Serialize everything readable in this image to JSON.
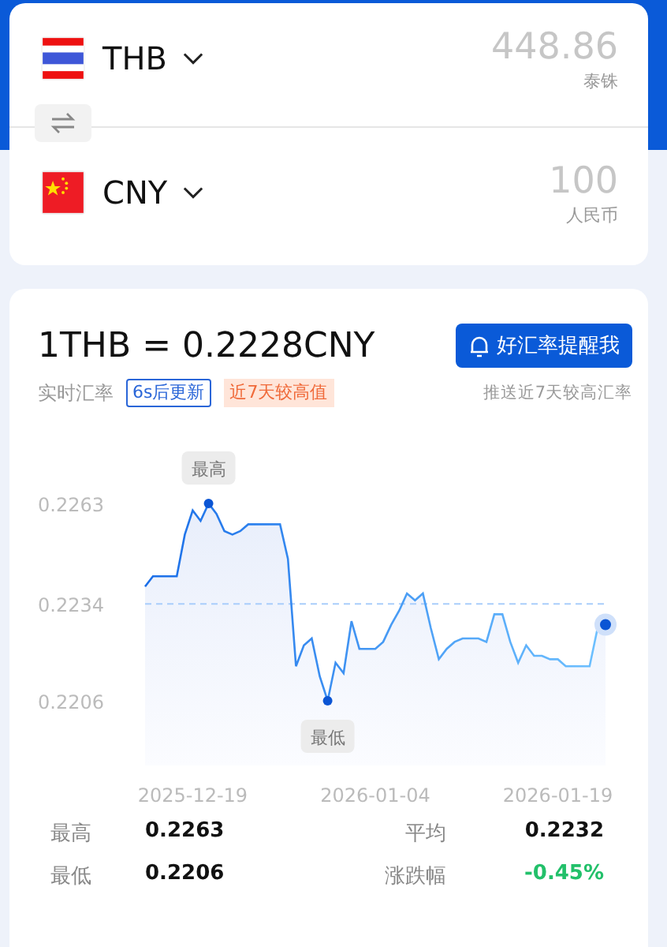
{
  "converter": {
    "currencies": [
      {
        "code": "THB",
        "amount": "448.86",
        "name": "泰铢"
      },
      {
        "code": "CNY",
        "amount": "100",
        "name": "人民币"
      }
    ]
  },
  "rate": {
    "title": "1THB = 0.2228CNY",
    "alert_button": "好汇率提醒我",
    "label": "实时汇率",
    "tags": [
      {
        "kind": "countdown",
        "text": "6s后更新"
      },
      {
        "kind": "highlight",
        "text": "近7天较高值"
      }
    ],
    "hint": "推送近7天较高汇率"
  },
  "chart_data": {
    "type": "area",
    "categories": [
      null,
      null,
      null,
      null,
      null,
      null,
      "2025-12-19",
      null,
      null,
      null,
      null,
      null,
      null,
      null,
      null,
      null,
      null,
      null,
      null,
      null,
      null,
      null,
      null,
      null,
      null,
      null,
      null,
      null,
      null,
      "2026-01-04",
      null,
      null,
      null,
      null,
      null,
      null,
      null,
      null,
      null,
      null,
      null,
      null,
      null,
      null,
      null,
      null,
      null,
      null,
      null,
      null,
      null,
      null,
      "2026-01-19",
      null,
      null,
      null,
      null,
      null,
      null
    ],
    "series": [
      {
        "color": "#1a6ee8",
        "values": [
          0.2239,
          0.2242,
          0.2242,
          0.2242,
          0.2242,
          0.2254,
          0.2261,
          0.2258,
          0.2263,
          0.226,
          0.2255,
          0.2254,
          0.2255,
          0.2257,
          0.2257,
          0.2257,
          0.2257,
          0.2257,
          0.2247,
          0.2216,
          0.2222,
          0.2224,
          0.2213,
          0.2206,
          0.2217,
          0.2214,
          0.2229,
          0.2221,
          0.2221,
          0.2221,
          0.2223,
          0.2228,
          0.2232,
          0.2237,
          0.2235,
          0.2237,
          0.2227,
          0.2218,
          0.2221,
          0.2223,
          0.2224,
          0.2224,
          0.2224,
          0.2223,
          0.2231,
          0.2231,
          0.2223,
          0.2217,
          0.2222,
          0.2219,
          0.2219,
          0.2218,
          0.2218,
          0.2216,
          0.2216,
          0.2216,
          0.2216,
          0.2227,
          0.2228
        ]
      }
    ],
    "ylim": [
      0.2206,
      0.2263
    ],
    "yticks": [
      {
        "value": 0.2263,
        "label": "0.2263"
      },
      {
        "value": 0.2234,
        "label": "0.2234"
      },
      {
        "value": 0.2206,
        "label": "0.2206"
      }
    ],
    "annotations": [
      {
        "text": "最高",
        "y": 0.2263
      },
      {
        "text": "最低",
        "y": 0.2206
      }
    ],
    "ref_lines": [
      {
        "axis": "y",
        "value": 0.2234
      }
    ]
  },
  "stats": [
    {
      "kind": "plain",
      "label": "最高",
      "value": "0.2263"
    },
    {
      "kind": "plain",
      "label": "平均",
      "value": "0.2232"
    },
    {
      "kind": "plain",
      "label": "最低",
      "value": "0.2206"
    },
    {
      "kind": "change",
      "label": "涨跌幅",
      "value": "-0.45%"
    }
  ]
}
